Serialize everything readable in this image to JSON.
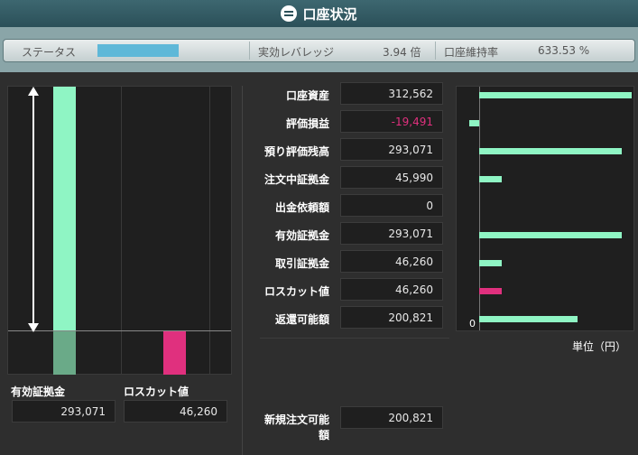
{
  "window": {
    "title": "口座状況"
  },
  "status": {
    "status_label": "ステータス",
    "status_fill": 1.0,
    "leverage_label": "実効レバレッジ",
    "leverage_value": "3.94 倍",
    "maintenance_label": "口座維持率",
    "maintenance_value": "633.53 %"
  },
  "left_chart": {
    "effective_margin_label": "有効証拠金",
    "effective_margin_value": "293,071",
    "losscut_label": "ロスカット値",
    "losscut_value": "46,260",
    "colors": {
      "effective": "#8ff5c4",
      "losscut": "#e0307e",
      "effective_below": "#6aaa88"
    }
  },
  "summary": {
    "rows": [
      {
        "label": "口座資産",
        "value": "312,562",
        "negative": false
      },
      {
        "label": "評価損益",
        "value": "-19,491",
        "negative": true
      },
      {
        "label": "預り評価残高",
        "value": "293,071",
        "negative": false
      },
      {
        "label": "注文中証拠金",
        "value": "45,990",
        "negative": false
      },
      {
        "label": "出金依頼額",
        "value": "0",
        "negative": false
      },
      {
        "label": "有効証拠金",
        "value": "293,071",
        "negative": false
      },
      {
        "label": "取引証拠金",
        "value": "46,260",
        "negative": false
      },
      {
        "label": "ロスカット値",
        "value": "46,260",
        "negative": false
      },
      {
        "label": "返還可能額",
        "value": "200,821",
        "negative": false
      }
    ],
    "new_order_label": "新規注文可能額",
    "new_order_value": "200,821",
    "negative_color": "#e0307e"
  },
  "chart_data": {
    "type": "bar",
    "orientation": "horizontal",
    "categories": [
      "口座資産",
      "評価損益",
      "預り評価残高",
      "注文中証拠金",
      "出金依頼額",
      "有効証拠金",
      "取引証拠金",
      "ロスカット値",
      "返還可能額"
    ],
    "values": [
      312562,
      -19491,
      293071,
      45990,
      0,
      293071,
      46260,
      46260,
      200821
    ],
    "colors": [
      "#8ff5c4",
      "#8ff5c4",
      "#8ff5c4",
      "#8ff5c4",
      "#8ff5c4",
      "#8ff5c4",
      "#8ff5c4",
      "#e0307e",
      "#8ff5c4"
    ],
    "zero_label": "0",
    "unit_label": "単位（円）",
    "xlim": [
      -19491,
      312562
    ]
  }
}
